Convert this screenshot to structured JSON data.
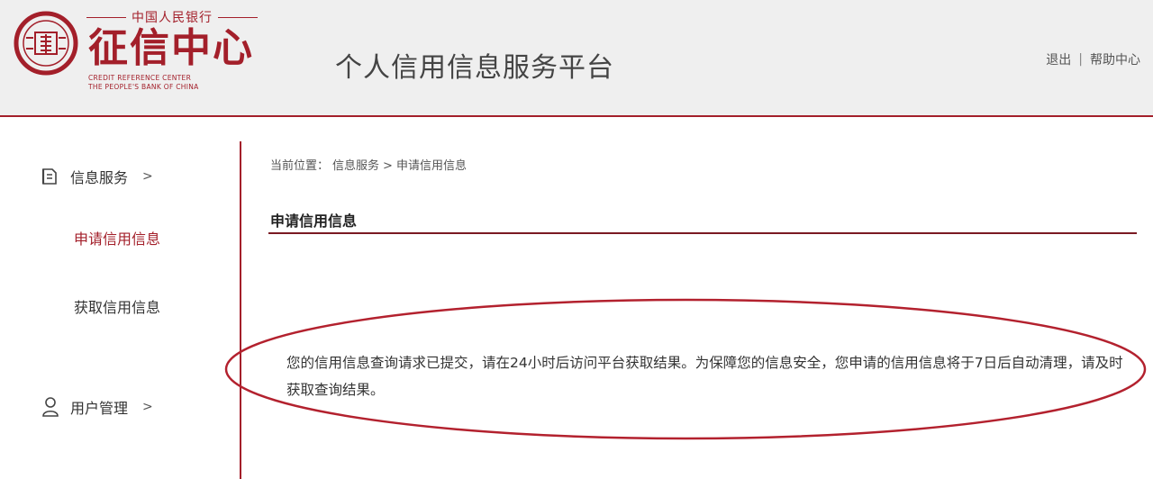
{
  "header": {
    "logo": {
      "top_text": "中国人民银行",
      "name": "征信中心",
      "english_line1": "CREDIT REFERENCE CENTER",
      "english_line2": "THE PEOPLE'S BANK OF CHINA"
    },
    "title": "个人信用信息服务平台",
    "links": {
      "logout": "退出",
      "separator": "|",
      "help": "帮助中心"
    }
  },
  "sidebar": {
    "info_service": {
      "label": "信息服务",
      "chevron": ">",
      "icon": "document-icon"
    },
    "sub_items": [
      {
        "label": "申请信用信息",
        "active": true
      },
      {
        "label": "获取信用信息",
        "active": false
      }
    ],
    "user_management": {
      "label": "用户管理",
      "chevron": ">",
      "icon": "user-icon"
    }
  },
  "main": {
    "breadcrumb": {
      "prefix": "当前位置：",
      "level1": "信息服务",
      "separator": ">",
      "level2": "申请信用信息"
    },
    "section_title": "申请信用信息",
    "notice": "您的信用信息查询请求已提交，请在24小时后访问平台获取结果。为保障您的信息安全，您申请的信用信息将于7日后自动清理，请及时获取查询结果。"
  },
  "colors": {
    "brand_red": "#a31f2a",
    "header_bg": "#efefef",
    "highlight_ellipse": "#b3212e"
  }
}
